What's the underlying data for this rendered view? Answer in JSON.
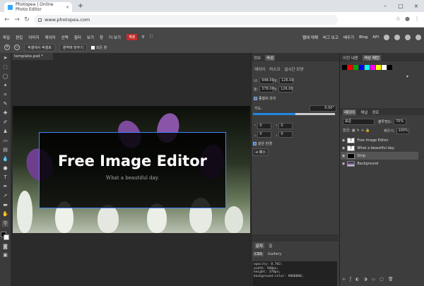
{
  "browser": {
    "tab_title": "Photopea | Online Photo Editor",
    "url": "www.photopea.com",
    "new_tab_glyph": "+",
    "close_glyph": "×",
    "minimize_glyph": "–",
    "maximize_glyph": "□",
    "back_glyph": "←",
    "forward_glyph": "→",
    "reload_glyph": "↻",
    "star_glyph": "☆",
    "profile_glyph": "●",
    "more_glyph": "⋮"
  },
  "menu": {
    "items": [
      "파일",
      "편집",
      "이미지",
      "레이어",
      "선택",
      "필터",
      "보기",
      "창",
      "더 보기"
    ],
    "account": "계정",
    "right_items": [
      "웹에 대해",
      "버그 보고",
      "배우기",
      "Blog",
      "API"
    ],
    "search_glyph": "⚲",
    "fullscreen_glyph": "⛶"
  },
  "options": {
    "fit_pixels": "픽셀에서 픽셀로",
    "fit_area": "영역에 맞추기",
    "all_windows": "모든 창"
  },
  "doc": {
    "tab_label": "template.psd *",
    "title": "Free Image Editor",
    "subtitle": "What a beautiful day."
  },
  "mid_panel": {
    "tabs": [
      "정보",
      "속성"
    ],
    "subtabs": [
      "레이어",
      "마스크",
      "실시간 모양"
    ],
    "w_label": "너:",
    "w_value": "948.00",
    "x_label": "X:",
    "x_value": "126.00",
    "h_label": "높:",
    "h_value": "378.00",
    "y_label": "Y:",
    "y_value": "126.00",
    "keep_ratio": "종횡비 유지",
    "angle_label": "각도:",
    "angle_value": "0.00°",
    "corner_values": [
      "0",
      "0",
      "0",
      "0"
    ],
    "same_radius": "같은 반경",
    "path_button": "패스",
    "tabs2": [
      "문자",
      "절"
    ],
    "tabs3": [
      "CSS",
      "Gallery"
    ],
    "css_lines": [
      "opacity: 0.702;",
      "width: 948px;",
      "height: 378px;",
      "background-color: #000000;"
    ]
  },
  "right_panel": {
    "top_tabs": [
      "이전 내용",
      "색상 패턴"
    ],
    "swatch_colors": [
      "#000000",
      "#ff0000",
      "#00aa00",
      "#0000ff",
      "#00ffff",
      "#ff00ff",
      "#ffff00",
      "#ffffff",
      "#000000"
    ],
    "layer_tabs": [
      "레이어",
      "채널",
      "경로"
    ],
    "blend_mode": "표준",
    "opacity_label": "불투명도:",
    "opacity_value": "70%",
    "lock_label": "잠금:",
    "fill_label": "채우기:",
    "fill_value": "100%",
    "layers": [
      {
        "name": "Free Image Editor",
        "type": "T"
      },
      {
        "name": "What a beautiful day.",
        "type": "T"
      },
      {
        "name": "Strip",
        "type": "shape"
      },
      {
        "name": "Background",
        "type": "image"
      }
    ]
  },
  "colors": {
    "accent": "#1e88e5",
    "account_red": "#c42b2b",
    "selection_outline": "#4682ff"
  }
}
